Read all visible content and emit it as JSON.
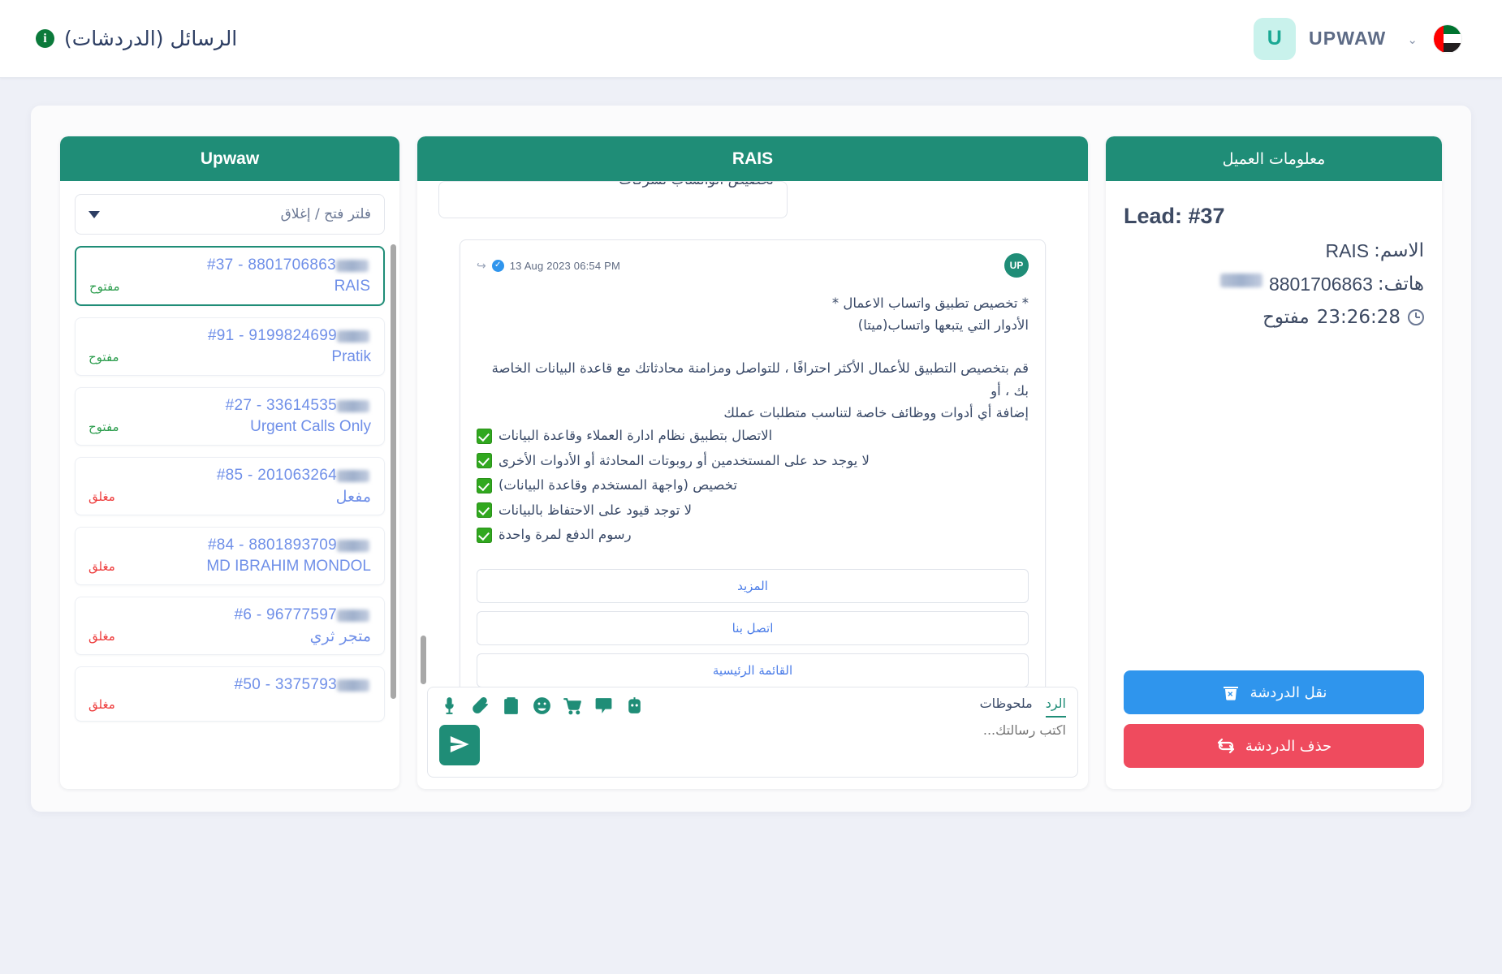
{
  "topbar": {
    "brand_initial": "U",
    "brand_name": "UPWAW",
    "caret": "⌄",
    "flag_name": "uae-flag",
    "page_title": "الرسائل (الدردشات)",
    "info_icon": "i"
  },
  "customer_panel": {
    "header": "معلومات العميل",
    "lead": "Lead: #37",
    "name_label": "الاسم:",
    "name_value": "RAIS",
    "phone_label": "هاتف:",
    "phone_value": "8801706863",
    "status_text": "مفتوح",
    "status_time": "23:26:28",
    "transfer_button": "نقل الدردشة",
    "delete_button": "حذف الدردشة"
  },
  "chat_panel": {
    "header": "RAIS",
    "cut_message": "تخصيص الواتساب لشركات",
    "message": {
      "timestamp": "13 Aug 2023 06:54 PM",
      "avatar": "UP",
      "title": "* تخصيص تطبيق واتساب الاعمال *",
      "subtitle": "الأدوار التي يتبعها واتساب(ميتا)",
      "paragraph1": "قم بتخصيص التطبيق للأعمال الأكثر احترافًا ، للتواصل ومزامنة محادثاتك مع قاعدة البيانات الخاصة بك ، أو",
      "paragraph2": "إضافة أي أدوات ووظائف خاصة لتناسب متطلبات عملك",
      "checklist": [
        "الاتصال بتطبيق نظام ادارة العملاء وقاعدة البيانات",
        "لا يوجد حد على المستخدمين أو روبوتات المحادثة أو الأدوات الأخرى",
        "تخصيص (واجهة المستخدم وقاعدة البيانات)",
        "لا توجد قيود على الاحتفاظ بالبيانات",
        "رسوم الدفع لمرة واحدة"
      ],
      "buttons": [
        "المزيد",
        "اتصل بنا",
        "القائمة الرئيسية"
      ]
    }
  },
  "composer": {
    "tabs": [
      {
        "label": "الرد",
        "active": true
      },
      {
        "label": "ملحوظات",
        "active": false
      }
    ],
    "placeholder": "اكتب رسالتك...",
    "icons": [
      "microphone-icon",
      "paperclip-icon",
      "clipboard-icon",
      "emoji-icon",
      "cart-icon",
      "template-message-icon",
      "robot-icon"
    ],
    "send_icon": "send-icon"
  },
  "list_panel": {
    "header": "Upwaw",
    "filter_label": "فلتر فتح / إغلاق",
    "items": [
      {
        "id": "#37 - 8801706863",
        "name": "RAIS",
        "name_ltr": true,
        "status": "مفتوح",
        "state": "open",
        "active": true
      },
      {
        "id": "#91 - 9199824699",
        "name": "Pratik",
        "name_ltr": true,
        "status": "مفتوح",
        "state": "open",
        "active": false
      },
      {
        "id": "#27 - 33614535",
        "name": "Urgent Calls Only",
        "name_ltr": true,
        "status": "مفتوح",
        "state": "open",
        "active": false
      },
      {
        "id": "#85 - 201063264",
        "name": "مفعل",
        "name_ltr": false,
        "status": "مغلق",
        "state": "closed",
        "active": false
      },
      {
        "id": "#84 - 8801893709",
        "name": "MD IBRAHIM MONDOL",
        "name_ltr": true,
        "status": "مغلق",
        "state": "closed",
        "active": false
      },
      {
        "id": "#6 - 96777597",
        "name": "متجر ثري",
        "name_ltr": false,
        "status": "مغلق",
        "state": "closed",
        "active": false
      },
      {
        "id": "#50 - 3375793",
        "name": "",
        "name_ltr": true,
        "status": "مغلق",
        "state": "closed",
        "active": false
      }
    ]
  },
  "colors": {
    "teal": "#1f8d77",
    "blue_button": "#2f95ed",
    "red_button": "#ef4b5e",
    "link_blue": "#6f8fe8",
    "open_green": "#2e9e4f",
    "closed_red": "#ee3b3b",
    "page_bg": "#eef0f7"
  }
}
